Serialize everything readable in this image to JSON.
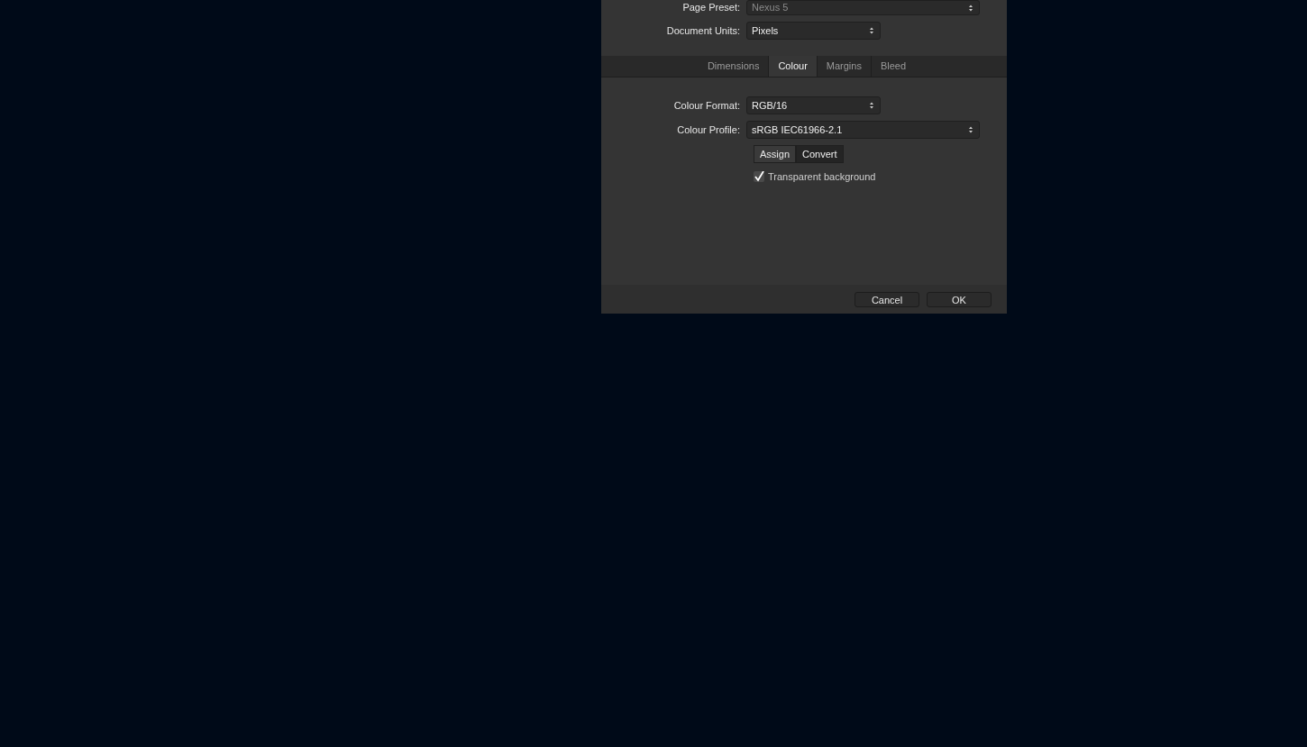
{
  "top_fields": [
    {
      "label": "Page Preset:",
      "value": "Nexus 5",
      "disabled": true,
      "wide": true
    },
    {
      "label": "Document Units:",
      "value": "Pixels",
      "disabled": false,
      "wide": false
    }
  ],
  "tabs": [
    {
      "label": "Dimensions",
      "selected": false
    },
    {
      "label": "Colour",
      "selected": true
    },
    {
      "label": "Margins",
      "selected": false
    },
    {
      "label": "Bleed",
      "selected": false
    }
  ],
  "colour_fields": [
    {
      "label": "Colour Format:",
      "value": "RGB/16",
      "wide": false
    },
    {
      "label": "Colour Profile:",
      "value": "sRGB IEC61966-2.1",
      "wide": true
    }
  ],
  "profile_buttons": [
    {
      "label": "Assign",
      "selected": false
    },
    {
      "label": "Convert",
      "selected": true
    }
  ],
  "transparent_background": {
    "label": "Transparent background",
    "checked": true
  },
  "buttons": [
    "Cancel",
    "OK"
  ]
}
